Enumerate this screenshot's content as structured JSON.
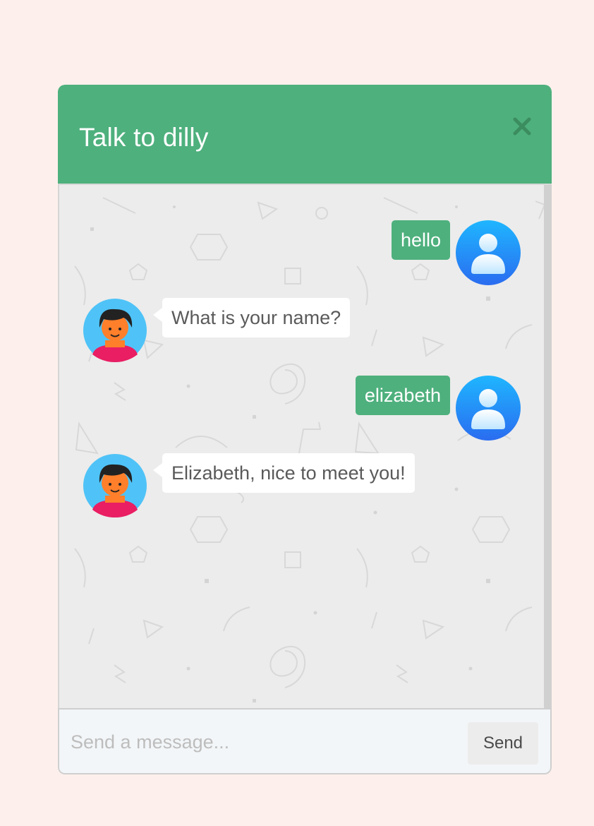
{
  "header": {
    "title": "Talk to dilly",
    "close_icon": "close-icon"
  },
  "colors": {
    "brand": "#4eb07d",
    "page_background": "#fdf0ec",
    "chat_background": "#ececec",
    "user_bubble": "#4eb07d",
    "bot_bubble": "#ffffff",
    "user_avatar": "#1e90ff",
    "bot_avatar_bg": "#4fc3f7"
  },
  "messages": [
    {
      "sender": "user",
      "text": "hello",
      "avatar_icon": "user-avatar-icon"
    },
    {
      "sender": "bot",
      "text": "What is your name?",
      "avatar_icon": "bot-avatar-icon"
    },
    {
      "sender": "user",
      "text": "elizabeth",
      "avatar_icon": "user-avatar-icon"
    },
    {
      "sender": "bot",
      "text": "Elizabeth, nice to meet you!",
      "avatar_icon": "bot-avatar-icon"
    }
  ],
  "composer": {
    "placeholder": "Send a message...",
    "value": "",
    "send_label": "Send"
  }
}
